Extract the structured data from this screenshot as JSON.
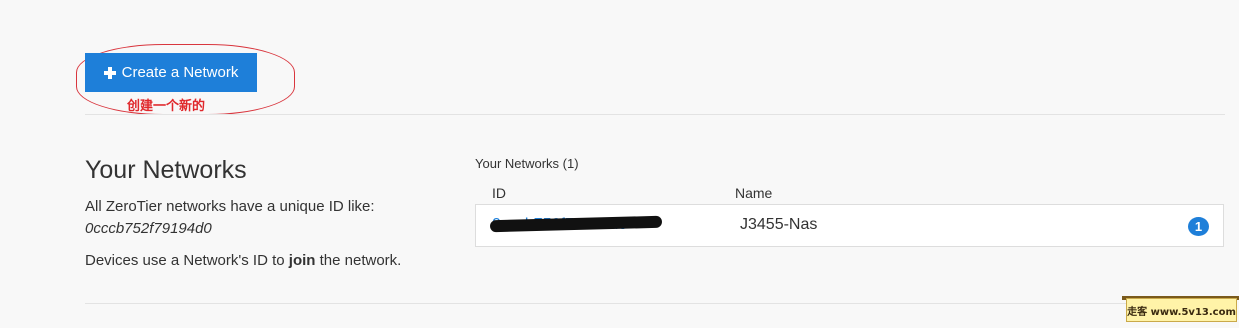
{
  "toolbar": {
    "create_label": "Create a Network",
    "annotation": "创建一个新的"
  },
  "intro": {
    "title": "Your Networks",
    "line1": "All ZeroTier networks have a unique ID like:",
    "example_id": "0cccb752f79194d0",
    "line2_pre": "Devices use a Network's ID to ",
    "line2_bold": "join",
    "line2_post": " the network."
  },
  "networks": {
    "count_label": "Your Networks (1)",
    "columns": {
      "id": "ID",
      "name": "Name"
    },
    "rows": [
      {
        "id": "0cccb752f79194d0",
        "name": "J3455-Nas",
        "members": "1"
      }
    ]
  },
  "watermark": {
    "text": "走客 www.5v13.com"
  },
  "colors": {
    "accent": "#1e7fd9",
    "annotation": "#e0282c",
    "background": "#f8f8f8"
  },
  "icons": {
    "create": "plus-icon"
  }
}
